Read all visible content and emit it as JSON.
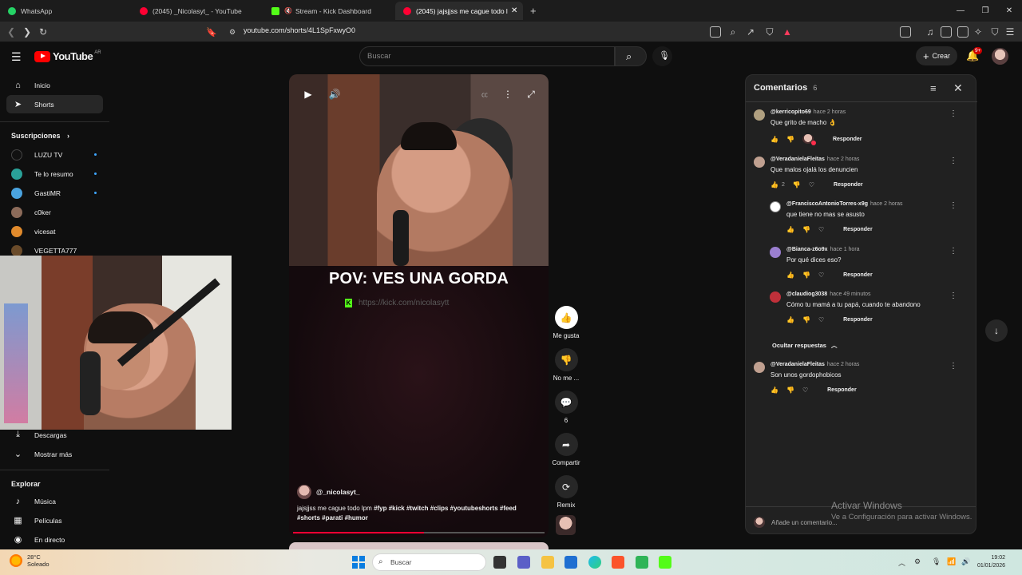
{
  "browser": {
    "tabs": [
      {
        "label": "WhatsApp",
        "color": "#25d366"
      },
      {
        "label": "(2045) _Nicolasyt_ - YouTube",
        "color": "#ff0033"
      },
      {
        "label": "Stream - Kick Dashboard",
        "color": "#53fc18"
      },
      {
        "label": "(2045) jajsjjss me cague todo lpm",
        "color": "#ff0033"
      }
    ],
    "url": "youtube.com/shorts/4L1SpFxwyO0"
  },
  "youtube": {
    "logo_text": "YouTube",
    "logo_country": "AR",
    "search_placeholder": "Buscar",
    "create_label": "Crear",
    "notifications_badge": "9+"
  },
  "sidebar": {
    "home_label": "Inicio",
    "shorts_label": "Shorts",
    "subscriptions_title": "Suscripciones",
    "subscriptions": [
      {
        "name": "LUZU TV",
        "color": "#111111"
      },
      {
        "name": "Te lo resumo",
        "color": "#2aa198"
      },
      {
        "name": "GastiMR",
        "color": "#4aa3df"
      },
      {
        "name": "c0ker",
        "color": "#8c6b5a"
      },
      {
        "name": "vicesat",
        "color": "#e08a2c"
      },
      {
        "name": "VEGETTA777",
        "color": "#6a4b2a"
      }
    ],
    "downloads_label": "Descargas",
    "show_more_label": "Mostrar más",
    "explore_title": "Explorar",
    "explore": [
      {
        "name": "Música"
      },
      {
        "name": "Películas"
      },
      {
        "name": "En directo"
      }
    ]
  },
  "video": {
    "overlay_text": "POV: VES UNA GORDA",
    "link_text": "https://kick.com/nicolasytt",
    "channel": "@_nicolasyt_",
    "description_prefix": "jajsjjss me cague todo lpm",
    "hashtags_line1": "#fyp #kick #twitch #clips #youtubeshorts #feed",
    "hashtags_line2": "#shorts #parati  #humor",
    "progress": 0.52
  },
  "actions": {
    "like_label": "Me gusta",
    "dislike_label": "No me ...",
    "comments_count": "6",
    "share_label": "Compartir",
    "remix_label": "Remix"
  },
  "comments": {
    "title": "Comentarios",
    "count": "6",
    "items": [
      {
        "user": "@kerricopito69",
        "time": "hace 2 horas",
        "text": "Que grito de macho 👌",
        "likes": "",
        "avatar": "#b0a080",
        "reply": "Responder"
      },
      {
        "user": "@VeradanielaFleitas",
        "time": "hace 2 horas",
        "text": "Que malos ojalá los denuncien",
        "likes": "2",
        "avatar": "#c0a090",
        "reply": "Responder"
      },
      {
        "user": "@FranciscoAntonioTorres-x9g",
        "time": "hace 2 horas",
        "text": "que tiene no mas se asusto",
        "likes": "",
        "avatar": "#ffffff",
        "reply": "Responder"
      },
      {
        "user": "@Bianca-z6o9x",
        "time": "hace 1 hora",
        "text": "Por qué dices eso?",
        "likes": "",
        "avatar": "#9b7fd0",
        "reply": "Responder"
      },
      {
        "user": "@claudiog3038",
        "time": "hace 49 minutos",
        "text": "Cómo tu mamá a tu papá, cuando te abandono",
        "likes": "",
        "avatar": "#c0303a",
        "reply": "Responder"
      },
      {
        "user": "@VeradanielaFleitas",
        "time": "hace 2 horas",
        "text": "Son unos gordophobicos",
        "likes": "",
        "avatar": "#c0a090",
        "reply": "Responder"
      }
    ],
    "hide_replies": "Ocultar respuestas",
    "add_placeholder": "Añade un comentario..."
  },
  "watermark": {
    "title": "Activar Windows",
    "subtitle": "Ve a Configuración para activar Windows."
  },
  "taskbar": {
    "temp": "28°C",
    "weather": "Soleado",
    "search": "Buscar",
    "time": "19:02",
    "date": "01/01/2026"
  }
}
